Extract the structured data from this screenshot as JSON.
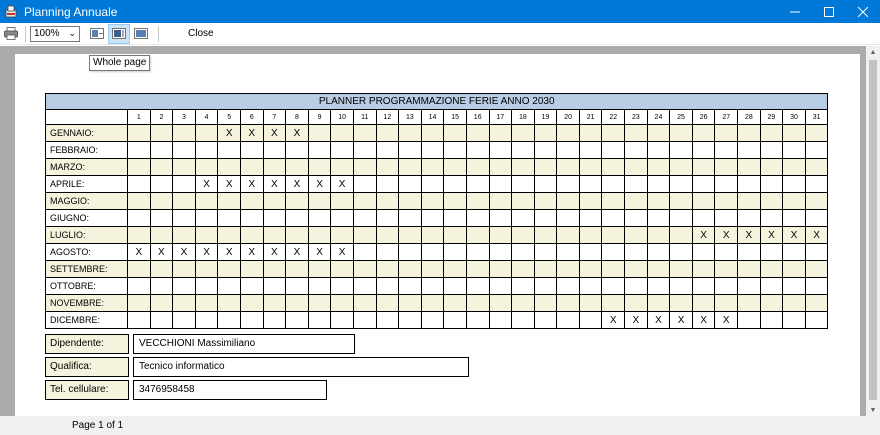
{
  "window": {
    "title": "Planning Annuale"
  },
  "toolbar": {
    "zoom_value": "100%",
    "close_label": "Close",
    "tooltip": "Whole page"
  },
  "report": {
    "title": "PLANNER PROGRAMMAZIONE FERIE ANNO 2030",
    "days": [
      "1",
      "2",
      "3",
      "4",
      "5",
      "6",
      "7",
      "8",
      "9",
      "10",
      "11",
      "12",
      "13",
      "14",
      "15",
      "16",
      "17",
      "18",
      "19",
      "20",
      "21",
      "22",
      "23",
      "24",
      "25",
      "26",
      "27",
      "28",
      "29",
      "30",
      "31"
    ],
    "months": [
      {
        "label": "GENNAIO:",
        "cells": [
          "",
          "",
          "",
          "",
          "X",
          "X",
          "X",
          "X",
          "",
          "",
          "",
          "",
          "",
          "",
          "",
          "",
          "",
          "",
          "",
          "",
          "",
          "",
          "",
          "",
          "",
          "",
          "",
          "",
          "",
          "",
          ""
        ]
      },
      {
        "label": "FEBBRAIO:",
        "cells": [
          "",
          "",
          "",
          "",
          "",
          "",
          "",
          "",
          "",
          "",
          "",
          "",
          "",
          "",
          "",
          "",
          "",
          "",
          "",
          "",
          "",
          "",
          "",
          "",
          "",
          "",
          "",
          "",
          "",
          "",
          ""
        ]
      },
      {
        "label": "MARZO:",
        "cells": [
          "",
          "",
          "",
          "",
          "",
          "",
          "",
          "",
          "",
          "",
          "",
          "",
          "",
          "",
          "",
          "",
          "",
          "",
          "",
          "",
          "",
          "",
          "",
          "",
          "",
          "",
          "",
          "",
          "",
          "",
          ""
        ]
      },
      {
        "label": "APRILE:",
        "cells": [
          "",
          "",
          "",
          "X",
          "X",
          "X",
          "X",
          "X",
          "X",
          "X",
          "",
          "",
          "",
          "",
          "",
          "",
          "",
          "",
          "",
          "",
          "",
          "",
          "",
          "",
          "",
          "",
          "",
          "",
          "",
          "",
          ""
        ]
      },
      {
        "label": "MAGGIO:",
        "cells": [
          "",
          "",
          "",
          "",
          "",
          "",
          "",
          "",
          "",
          "",
          "",
          "",
          "",
          "",
          "",
          "",
          "",
          "",
          "",
          "",
          "",
          "",
          "",
          "",
          "",
          "",
          "",
          "",
          "",
          "",
          ""
        ]
      },
      {
        "label": "GIUGNO:",
        "cells": [
          "",
          "",
          "",
          "",
          "",
          "",
          "",
          "",
          "",
          "",
          "",
          "",
          "",
          "",
          "",
          "",
          "",
          "",
          "",
          "",
          "",
          "",
          "",
          "",
          "",
          "",
          "",
          "",
          "",
          "",
          ""
        ]
      },
      {
        "label": "LUGLIO:",
        "cells": [
          "",
          "",
          "",
          "",
          "",
          "",
          "",
          "",
          "",
          "",
          "",
          "",
          "",
          "",
          "",
          "",
          "",
          "",
          "",
          "",
          "",
          "",
          "",
          "",
          "",
          "X",
          "X",
          "X",
          "X",
          "X",
          "X"
        ]
      },
      {
        "label": "AGOSTO:",
        "cells": [
          "X",
          "X",
          "X",
          "X",
          "X",
          "X",
          "X",
          "X",
          "X",
          "X",
          "",
          "",
          "",
          "",
          "",
          "",
          "",
          "",
          "",
          "",
          "",
          "",
          "",
          "",
          "",
          "",
          "",
          "",
          "",
          "",
          ""
        ]
      },
      {
        "label": "SETTEMBRE:",
        "cells": [
          "",
          "",
          "",
          "",
          "",
          "",
          "",
          "",
          "",
          "",
          "",
          "",
          "",
          "",
          "",
          "",
          "",
          "",
          "",
          "",
          "",
          "",
          "",
          "",
          "",
          "",
          "",
          "",
          "",
          "",
          ""
        ]
      },
      {
        "label": "OTTOBRE:",
        "cells": [
          "",
          "",
          "",
          "",
          "",
          "",
          "",
          "",
          "",
          "",
          "",
          "",
          "",
          "",
          "",
          "",
          "",
          "",
          "",
          "",
          "",
          "",
          "",
          "",
          "",
          "",
          "",
          "",
          "",
          "",
          ""
        ]
      },
      {
        "label": "NOVEMBRE:",
        "cells": [
          "",
          "",
          "",
          "",
          "",
          "",
          "",
          "",
          "",
          "",
          "",
          "",
          "",
          "",
          "",
          "",
          "",
          "",
          "",
          "",
          "",
          "",
          "",
          "",
          "",
          "",
          "",
          "",
          "",
          "",
          ""
        ]
      },
      {
        "label": "DICEMBRE:",
        "cells": [
          "",
          "",
          "",
          "",
          "",
          "",
          "",
          "",
          "",
          "",
          "",
          "",
          "",
          "",
          "",
          "",
          "",
          "",
          "",
          "",
          "",
          "X",
          "X",
          "X",
          "X",
          "X",
          "X",
          "",
          "",
          "",
          ""
        ]
      }
    ],
    "employee": {
      "label": "Dipendente:",
      "value": "VECCHIONI Massimiliano"
    },
    "role": {
      "label": "Qualifica:",
      "value": "Tecnico informatico"
    },
    "phone": {
      "label": "Tel. cellulare:",
      "value": "3476958458"
    }
  },
  "status": {
    "page_text": "Page 1 of 1"
  },
  "colors": {
    "titlebar": "#0078d7",
    "header_fill": "#b8cce4",
    "row_alt_fill": "#f5f3dd"
  }
}
